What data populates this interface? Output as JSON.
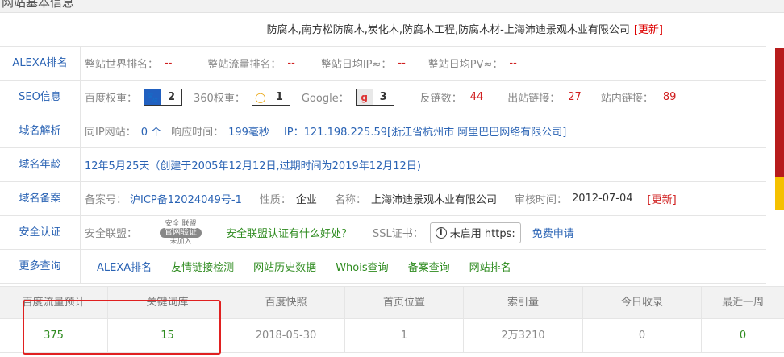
{
  "section": {
    "title": "网站基本信息"
  },
  "site": {
    "title": "防腐木,南方松防腐木,炭化木,防腐木工程,防腐木材-上海沛迪景观木业有限公司",
    "update": "[更新]"
  },
  "alexa": {
    "label": "ALEXA排名",
    "world_rank_label": "整站世界排名：",
    "world_rank": "--",
    "traffic_rank_label": "整站流量排名：",
    "traffic_rank": "--",
    "daily_ip_label": "整站日均IP≈：",
    "daily_ip": "--",
    "daily_pv_label": "整站日均PV≈：",
    "daily_pv": "--"
  },
  "seo": {
    "label": "SEO信息",
    "baidu_label": "百度权重：",
    "baidu_icon": "paw-icon",
    "baidu_value": "2",
    "s360_label": "360权重：",
    "s360_icon": "ring-icon",
    "s360_value": "1",
    "google_label": "Google：",
    "google_icon": "google-icon",
    "google_value": "3",
    "backlinks_label": "反链数：",
    "backlinks": "44",
    "outlinks_label": "出站链接：",
    "outlinks": "27",
    "inlinks_label": "站内链接：",
    "inlinks": "89"
  },
  "domain": {
    "label": "域名解析",
    "same_ip_label": "同IP网站：",
    "same_ip": "0 个",
    "response_label": "响应时间：",
    "response": "199毫秒",
    "ip_label": "IP：",
    "ip": "121.198.225.59[浙江省杭州市 阿里巴巴网络有限公司]"
  },
  "age": {
    "label": "域名年龄",
    "text": "12年5月25天（创建于2005年12月12日,过期时间为2019年12月12日)"
  },
  "icp": {
    "label": "域名备案",
    "no_label": "备案号：",
    "no": "沪ICP备12024049号-1",
    "nature_label": "性质：",
    "nature": "企业",
    "name_label": "名称：",
    "name": "上海沛迪景观木业有限公司",
    "audit_label": "审核时间：",
    "audit": "2012-07-04",
    "update": "[更新]"
  },
  "security": {
    "label": "安全认证",
    "alliance_label": "安全联盟：",
    "seal_top": "安全 联盟",
    "seal_main": "官网验证",
    "seal_sub": "未加入",
    "alliance_link": "安全联盟认证有什么好处？",
    "ssl_label": "SSL证书：",
    "ssl_status": "未启用 https:",
    "apply": "免费申请"
  },
  "more": {
    "label": "更多查询",
    "links": [
      "ALEXA排名",
      "友情链接检测",
      "网站历史数据",
      "Whois查询",
      "备案查询",
      "网站排名"
    ]
  },
  "stats": {
    "headers": [
      "百度流量预计",
      "关键词库",
      "百度快照",
      "首页位置",
      "索引量",
      "今日收录",
      "最近一周"
    ],
    "values": [
      "375",
      "15",
      "2018-05-30",
      "1",
      "2万3210",
      "0",
      "0"
    ]
  },
  "colors": {
    "link": "#2a63b4",
    "value_red": "#d02020",
    "value_green": "#2e8b1f",
    "highlight": "#e02020"
  }
}
